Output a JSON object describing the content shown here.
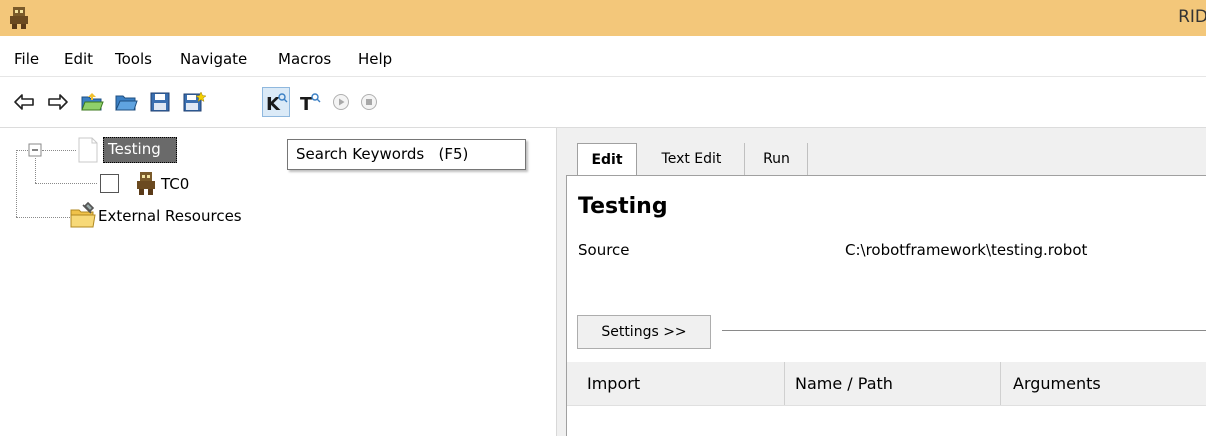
{
  "window": {
    "title": "RID"
  },
  "menu": [
    "File",
    "Edit",
    "Tools",
    "Navigate",
    "Macros",
    "Help"
  ],
  "toolbar": {
    "buttons": [
      "back-arrow-icon",
      "forward-arrow-icon",
      "open-directory-icon",
      "open-folder-icon",
      "save-icon",
      "save-all-icon",
      "search-keywords-icon",
      "search-tests-icon",
      "run-icon",
      "stop-icon"
    ]
  },
  "tree": {
    "root": "Testing",
    "test_case": "TC0",
    "external": "External Resources"
  },
  "tooltip": {
    "text": "Search Keywords   (F5)"
  },
  "tabs": [
    "Edit",
    "Text Edit",
    "Run"
  ],
  "editor": {
    "title": "Testing",
    "source_label": "Source",
    "source_value": "C:\\robotframework\\testing.robot",
    "settings_button": "Settings >>",
    "columns": [
      "Import",
      "Name / Path",
      "Arguments"
    ]
  },
  "colors": {
    "titlebar": "#f3c77a",
    "selection": "#6a6a6a"
  }
}
